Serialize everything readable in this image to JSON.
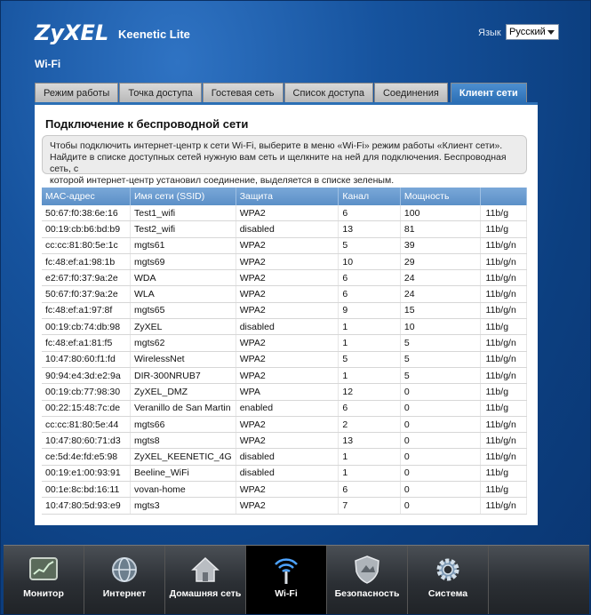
{
  "header": {
    "logo": "ZyXEL",
    "model": "Keenetic Lite",
    "language_label": "Язык",
    "language_value": "Русский",
    "section": "Wi-Fi"
  },
  "tabs": [
    {
      "label": "Режим работы",
      "active": false
    },
    {
      "label": "Точка доступа",
      "active": false
    },
    {
      "label": "Гостевая сеть",
      "active": false
    },
    {
      "label": "Список доступа",
      "active": false
    },
    {
      "label": "Соединения",
      "active": false
    },
    {
      "label": "Клиент сети",
      "active": true
    }
  ],
  "panel": {
    "title": "Подключение к беспроводной сети",
    "info_lines": [
      "Чтобы подключить интернет-центр к сети Wi-Fi, выберите в меню «Wi-Fi» режим работы «Клиент сети».",
      "Найдите в списке доступных сетей нужную вам сеть и щелкните на ней для подключения. Беспроводная сеть, с",
      "которой интернет-центр установил соединение, выделяется в списке зеленым."
    ]
  },
  "table": {
    "columns": [
      "MAC-адрес",
      "Имя сети (SSID)",
      "Защита",
      "Канал",
      "Мощность",
      ""
    ],
    "rows": [
      [
        "50:67:f0:38:6e:16",
        "Test1_wifi",
        "WPA2",
        "6",
        "100",
        "11b/g"
      ],
      [
        "00:19:cb:b6:bd:b9",
        "Test2_wifi",
        "disabled",
        "13",
        "81",
        "11b/g"
      ],
      [
        "cc:cc:81:80:5e:1c",
        "mgts61",
        "WPA2",
        "5",
        "39",
        "11b/g/n"
      ],
      [
        "fc:48:ef:a1:98:1b",
        "mgts69",
        "WPA2",
        "10",
        "29",
        "11b/g/n"
      ],
      [
        "e2:67:f0:37:9a:2e",
        "WDA",
        "WPA2",
        "6",
        "24",
        "11b/g/n"
      ],
      [
        "50:67:f0:37:9a:2e",
        "WLA",
        "WPA2",
        "6",
        "24",
        "11b/g/n"
      ],
      [
        "fc:48:ef:a1:97:8f",
        "mgts65",
        "WPA2",
        "9",
        "15",
        "11b/g/n"
      ],
      [
        "00:19:cb:74:db:98",
        "ZyXEL",
        "disabled",
        "1",
        "10",
        "11b/g"
      ],
      [
        "fc:48:ef:a1:81:f5",
        "mgts62",
        "WPA2",
        "1",
        "5",
        "11b/g/n"
      ],
      [
        "10:47:80:60:f1:fd",
        "WirelessNet",
        "WPA2",
        "5",
        "5",
        "11b/g/n"
      ],
      [
        "90:94:e4:3d:e2:9a",
        "DIR-300NRUB7",
        "WPA2",
        "1",
        "5",
        "11b/g/n"
      ],
      [
        "00:19:cb:77:98:30",
        "ZyXEL_DMZ",
        "WPA",
        "12",
        "0",
        "11b/g"
      ],
      [
        "00:22:15:48:7c:de",
        "Veranillo de San Martin",
        "enabled",
        "6",
        "0",
        "11b/g"
      ],
      [
        "cc:cc:81:80:5e:44",
        "mgts66",
        "WPA2",
        "2",
        "0",
        "11b/g/n"
      ],
      [
        "10:47:80:60:71:d3",
        "mgts8",
        "WPA2",
        "13",
        "0",
        "11b/g/n"
      ],
      [
        "ce:5d:4e:fd:e5:98",
        "ZyXEL_KEENETIC_4G",
        "disabled",
        "1",
        "0",
        "11b/g/n"
      ],
      [
        "00:19:e1:00:93:91",
        "Beeline_WiFi",
        "disabled",
        "1",
        "0",
        "11b/g"
      ],
      [
        "00:1e:8c:bd:16:11",
        "vovan-home",
        "WPA2",
        "6",
        "0",
        "11b/g"
      ],
      [
        "10:47:80:5d:93:e9",
        "mgts3",
        "WPA2",
        "7",
        "0",
        "11b/g/n"
      ]
    ]
  },
  "dock": [
    {
      "label": "Монитор",
      "icon": "monitor-icon",
      "active": false
    },
    {
      "label": "Интернет",
      "icon": "globe-icon",
      "active": false
    },
    {
      "label": "Домашняя сеть",
      "icon": "home-icon",
      "active": false
    },
    {
      "label": "Wi-Fi",
      "icon": "wifi-icon",
      "active": true
    },
    {
      "label": "Безопасность",
      "icon": "shield-icon",
      "active": false
    },
    {
      "label": "Система",
      "icon": "gear-icon",
      "active": false
    }
  ]
}
